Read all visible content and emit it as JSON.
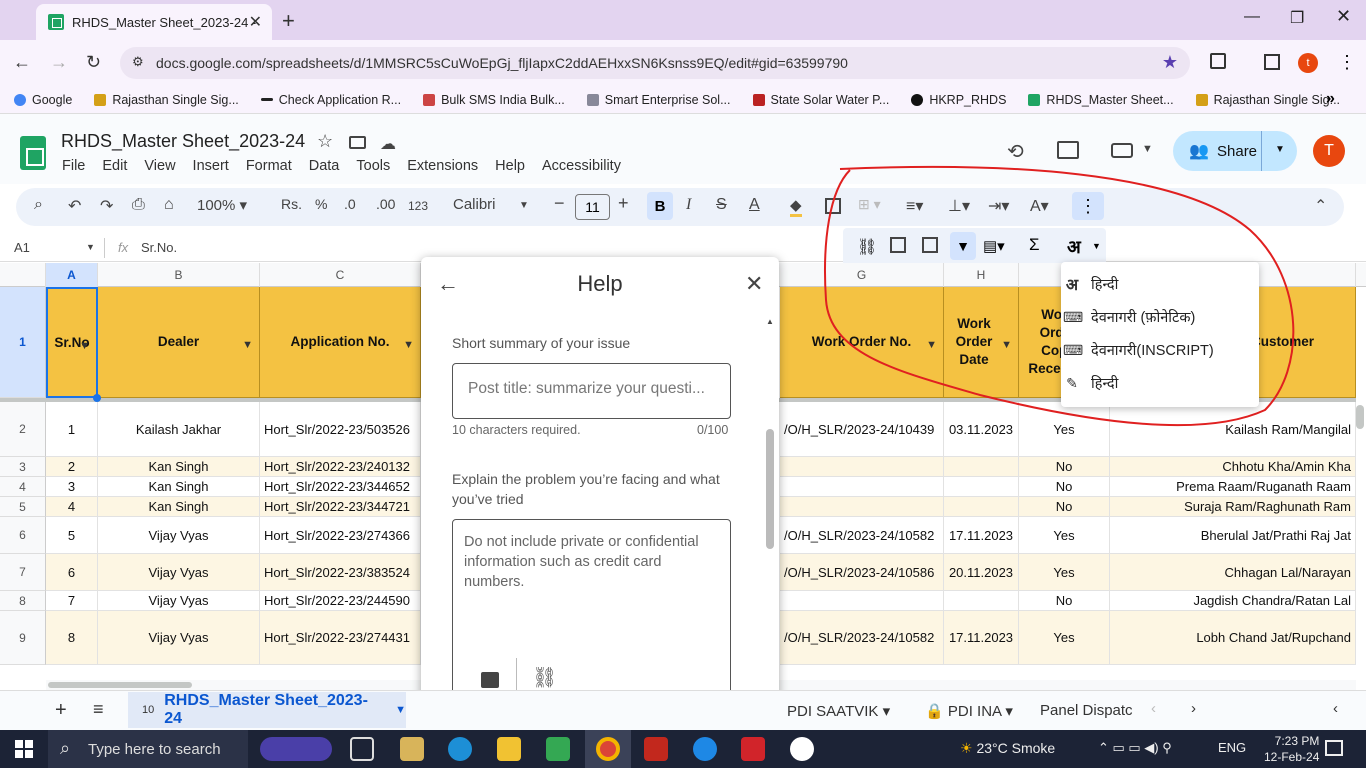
{
  "browser": {
    "tab_title": "RHDS_Master Sheet_2023-24 - ",
    "url": "docs.google.com/spreadsheets/d/1MMSRC5sCuWoEpGj_fljIapxC2ddAEHxxSN6Ksnss9EQ/edit#gid=63599790",
    "profile_initial": "t",
    "bookmarks": [
      "Google",
      "Rajasthan Single Sig...",
      "Check Application R...",
      "Bulk SMS India Bulk...",
      "Smart Enterprise Sol...",
      "State Solar Water P...",
      "HKRP_RHDS",
      "RHDS_Master Sheet...",
      "Rajasthan Single Sig..."
    ]
  },
  "sheets": {
    "doc_title": "RHDS_Master Sheet_2023-24",
    "menu": [
      "File",
      "Edit",
      "View",
      "Insert",
      "Format",
      "Data",
      "Tools",
      "Extensions",
      "Help",
      "Accessibility"
    ],
    "share_label": "Share",
    "user_initial": "T",
    "toolbar": {
      "zoom": "100%",
      "currency": "Rs.",
      "percent": "%",
      "dec_dec": ".0",
      "inc_dec": ".00",
      "format_num": "123",
      "font": "Calibri",
      "font_size": "11",
      "bold": "B",
      "italic": "I",
      "lang_glyph": "अ"
    },
    "name_box": "A1",
    "fx": "fx",
    "formula": "Sr.No."
  },
  "grid": {
    "columns": [
      "A",
      "B",
      "C",
      "G",
      "H",
      "I",
      "J"
    ],
    "headers": {
      "a": "Sr.No",
      "b": "Dealer",
      "c": "Application No.",
      "g": "Work Order No.",
      "h": "Work Order Date",
      "i": "Work Order Copy Received",
      "j": "Customer"
    },
    "row_numbers": [
      "1",
      "2",
      "3",
      "4",
      "5",
      "6",
      "7",
      "8",
      "9"
    ],
    "rows": [
      {
        "sr": "1",
        "dealer": "Kailash Jakhar",
        "app": "Hort_Slr/2022-23/503526",
        "wo": "/O/H_SLR/2023-24/10439",
        "date": "03.11.2023",
        "rec": "Yes",
        "cust": "Kailash Ram/Mangilal"
      },
      {
        "sr": "2",
        "dealer": "Kan Singh",
        "app": "Hort_Slr/2022-23/240132",
        "wo": "",
        "date": "",
        "rec": "No",
        "cust": "Chhotu Kha/Amin Kha"
      },
      {
        "sr": "3",
        "dealer": "Kan Singh",
        "app": "Hort_Slr/2022-23/344652",
        "wo": "",
        "date": "",
        "rec": "No",
        "cust": "Prema Raam/Ruganath Raam"
      },
      {
        "sr": "4",
        "dealer": "Kan Singh",
        "app": "Hort_Slr/2022-23/344721",
        "wo": "",
        "date": "",
        "rec": "No",
        "cust": "Suraja Ram/Raghunath Ram"
      },
      {
        "sr": "5",
        "dealer": "Vijay Vyas",
        "app": "Hort_Slr/2022-23/274366",
        "wo": "/O/H_SLR/2023-24/10582",
        "date": "17.11.2023",
        "rec": "Yes",
        "cust": "Bherulal Jat/Prathi Raj Jat"
      },
      {
        "sr": "6",
        "dealer": "Vijay Vyas",
        "app": "Hort_Slr/2022-23/383524",
        "wo": "/O/H_SLR/2023-24/10586",
        "date": "20.11.2023",
        "rec": "Yes",
        "cust": "Chhagan Lal/Narayan"
      },
      {
        "sr": "7",
        "dealer": "Vijay Vyas",
        "app": "Hort_Slr/2022-23/244590",
        "wo": "",
        "date": "",
        "rec": "No",
        "cust": "Jagdish Chandra/Ratan Lal"
      },
      {
        "sr": "8",
        "dealer": "Vijay Vyas",
        "app": "Hort_Slr/2022-23/274431",
        "wo": "/O/H_SLR/2023-24/10582",
        "date": "17.11.2023",
        "rec": "Yes",
        "cust": "Lobh Chand Jat/Rupchand"
      }
    ]
  },
  "help_dialog": {
    "title": "Help",
    "summary_label": "Short summary of your issue",
    "summary_placeholder": "Post title: summarize your questi...",
    "summary_hint": "10 characters required.",
    "summary_count": "0/100",
    "explain_label": "Explain the problem you’re facing and what you’ve tried",
    "explain_placeholder": "Do not include private or confidential information such as credit card numbers."
  },
  "lang_menu": {
    "items": [
      {
        "icon": "अ",
        "label": "हिन्दी"
      },
      {
        "icon": "keyboard-icon",
        "label": "देवनागरी (फ़ोनेटिक)"
      },
      {
        "icon": "keyboard-icon",
        "label": "देवनागरी(INSCRIPT)"
      },
      {
        "icon": "pencil-icon",
        "label": "हिन्दी"
      }
    ]
  },
  "sheet_tabs": {
    "count": "10",
    "active": "RHDS_Master Sheet_2023-24",
    "others": [
      "PDI SAATVIK",
      "PDI INA",
      "Panel Dispatc"
    ]
  },
  "taskbar": {
    "search_placeholder": "Type here to search",
    "weather": "23°C  Smoke",
    "lang": "ENG",
    "time": "7:23 PM",
    "date": "12-Feb-24"
  },
  "colors": {
    "header_fill": "#f4c242",
    "annotation_red": "#e02020",
    "share_bg": "#c2e7ff"
  }
}
